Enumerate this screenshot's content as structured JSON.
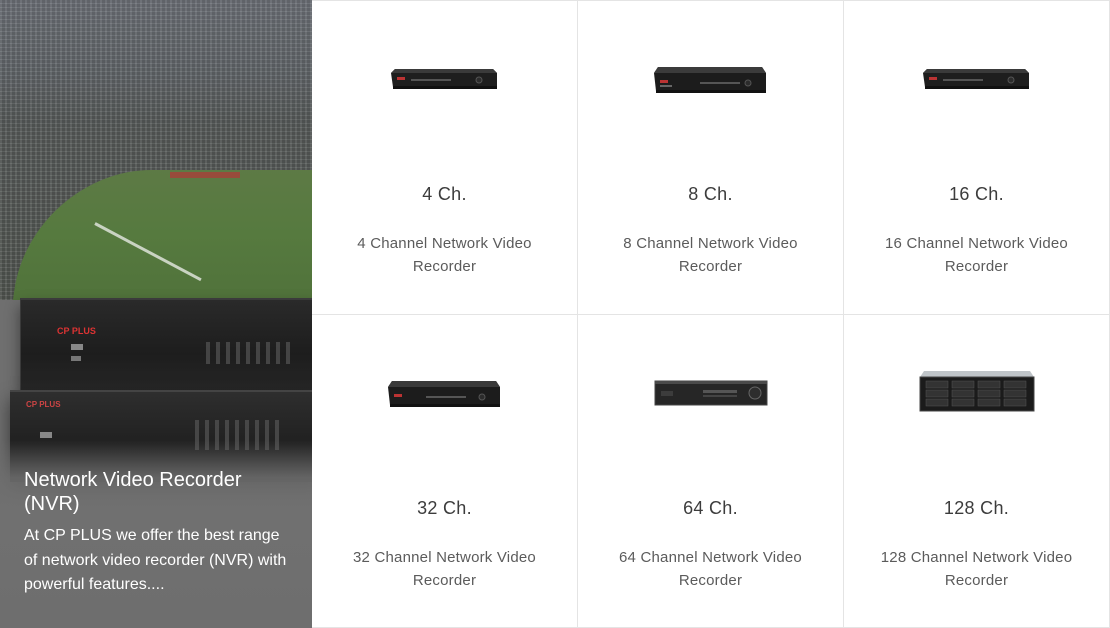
{
  "hero": {
    "title": "Network Video Recorder (NVR)",
    "description": "At CP PLUS we offer the best range of network video recorder (NVR) with powerful features....",
    "brand_mark": "CP PLUS"
  },
  "products": [
    {
      "channels": "4 Ch.",
      "name": "4 Channel Network Video Recorder",
      "icon": "nvr-slim-icon"
    },
    {
      "channels": "8 Ch.",
      "name": "8 Channel Network Video Recorder",
      "icon": "nvr-slim-icon"
    },
    {
      "channels": "16 Ch.",
      "name": "16 Channel Network Video Recorder",
      "icon": "nvr-slim-icon"
    },
    {
      "channels": "32 Ch.",
      "name": "32 Channel Network Video Recorder",
      "icon": "nvr-slim-icon"
    },
    {
      "channels": "64 Ch.",
      "name": "64 Channel Network Video Recorder",
      "icon": "nvr-rack-icon"
    },
    {
      "channels": "128 Ch.",
      "name": "128 Channel Network Video Recorder",
      "icon": "nvr-storage-server-icon"
    }
  ]
}
